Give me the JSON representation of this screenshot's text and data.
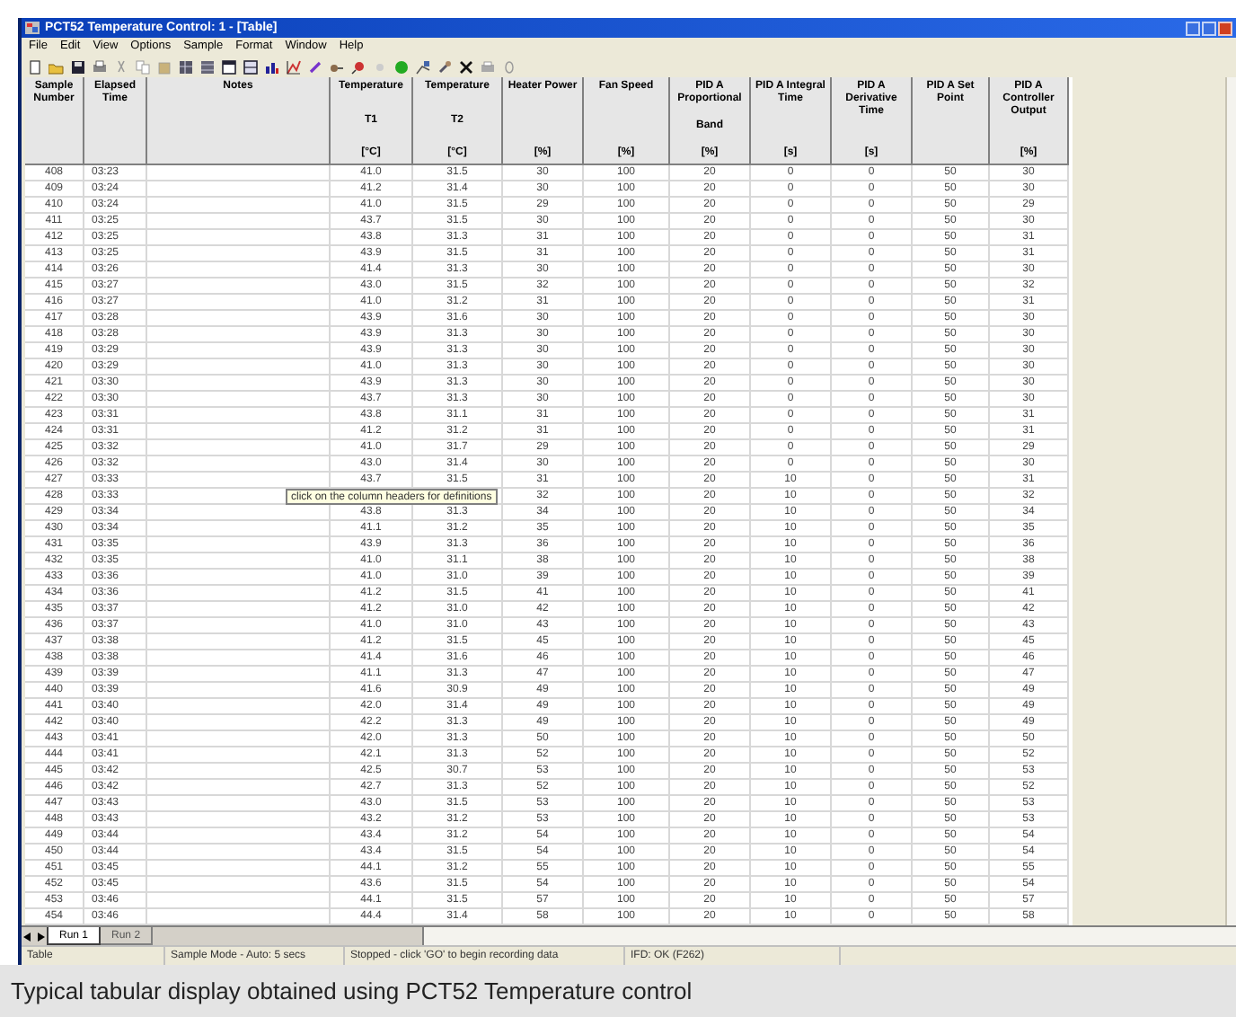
{
  "window": {
    "title": "PCT52 Temperature Control: 1 - [Table]"
  },
  "menu": [
    "File",
    "Edit",
    "View",
    "Options",
    "Sample",
    "Format",
    "Window",
    "Help"
  ],
  "table": {
    "columns": [
      {
        "title": "Sample Number"
      },
      {
        "title": "Elapsed Time"
      },
      {
        "title": "Notes"
      },
      {
        "title": "Temperature",
        "symbol": "T1",
        "unit": "[°C]"
      },
      {
        "title": "Temperature",
        "symbol": "T2",
        "unit": "[°C]"
      },
      {
        "title": "Heater Power",
        "unit": "[%]"
      },
      {
        "title": "Fan Speed",
        "unit": "[%]"
      },
      {
        "title": "PID A Proportional",
        "symbol": "Band",
        "unit": "[%]"
      },
      {
        "title": "PID A Integral Time",
        "unit": "[s]"
      },
      {
        "title": "PID A Derivative Time",
        "unit": "[s]"
      },
      {
        "title": "PID A Set Point"
      },
      {
        "title": "PID A Controller Output",
        "unit": "[%]"
      }
    ],
    "rows": [
      [
        "408",
        "03:23",
        "",
        "41.0",
        "31.5",
        "30",
        "100",
        "20",
        "0",
        "0",
        "50",
        "30"
      ],
      [
        "409",
        "03:24",
        "",
        "41.2",
        "31.4",
        "30",
        "100",
        "20",
        "0",
        "0",
        "50",
        "30"
      ],
      [
        "410",
        "03:24",
        "",
        "41.0",
        "31.5",
        "29",
        "100",
        "20",
        "0",
        "0",
        "50",
        "29"
      ],
      [
        "411",
        "03:25",
        "",
        "43.7",
        "31.5",
        "30",
        "100",
        "20",
        "0",
        "0",
        "50",
        "30"
      ],
      [
        "412",
        "03:25",
        "",
        "43.8",
        "31.3",
        "31",
        "100",
        "20",
        "0",
        "0",
        "50",
        "31"
      ],
      [
        "413",
        "03:25",
        "",
        "43.9",
        "31.5",
        "31",
        "100",
        "20",
        "0",
        "0",
        "50",
        "31"
      ],
      [
        "414",
        "03:26",
        "",
        "41.4",
        "31.3",
        "30",
        "100",
        "20",
        "0",
        "0",
        "50",
        "30"
      ],
      [
        "415",
        "03:27",
        "",
        "43.0",
        "31.5",
        "32",
        "100",
        "20",
        "0",
        "0",
        "50",
        "32"
      ],
      [
        "416",
        "03:27",
        "",
        "41.0",
        "31.2",
        "31",
        "100",
        "20",
        "0",
        "0",
        "50",
        "31"
      ],
      [
        "417",
        "03:28",
        "",
        "43.9",
        "31.6",
        "30",
        "100",
        "20",
        "0",
        "0",
        "50",
        "30"
      ],
      [
        "418",
        "03:28",
        "",
        "43.9",
        "31.3",
        "30",
        "100",
        "20",
        "0",
        "0",
        "50",
        "30"
      ],
      [
        "419",
        "03:29",
        "",
        "43.9",
        "31.3",
        "30",
        "100",
        "20",
        "0",
        "0",
        "50",
        "30"
      ],
      [
        "420",
        "03:29",
        "",
        "41.0",
        "31.3",
        "30",
        "100",
        "20",
        "0",
        "0",
        "50",
        "30"
      ],
      [
        "421",
        "03:30",
        "",
        "43.9",
        "31.3",
        "30",
        "100",
        "20",
        "0",
        "0",
        "50",
        "30"
      ],
      [
        "422",
        "03:30",
        "",
        "43.7",
        "31.3",
        "30",
        "100",
        "20",
        "0",
        "0",
        "50",
        "30"
      ],
      [
        "423",
        "03:31",
        "",
        "43.8",
        "31.1",
        "31",
        "100",
        "20",
        "0",
        "0",
        "50",
        "31"
      ],
      [
        "424",
        "03:31",
        "",
        "41.2",
        "31.2",
        "31",
        "100",
        "20",
        "0",
        "0",
        "50",
        "31"
      ],
      [
        "425",
        "03:32",
        "",
        "41.0",
        "31.7",
        "29",
        "100",
        "20",
        "0",
        "0",
        "50",
        "29"
      ],
      [
        "426",
        "03:32",
        "",
        "43.0",
        "31.4",
        "30",
        "100",
        "20",
        "0",
        "0",
        "50",
        "30"
      ],
      [
        "427",
        "03:33",
        "",
        "43.7",
        "31.5",
        "31",
        "100",
        "20",
        "10",
        "0",
        "50",
        "31"
      ],
      [
        "428",
        "03:33",
        "",
        "",
        "",
        "32",
        "100",
        "20",
        "10",
        "0",
        "50",
        "32"
      ],
      [
        "429",
        "03:34",
        "",
        "43.8",
        "31.3",
        "34",
        "100",
        "20",
        "10",
        "0",
        "50",
        "34"
      ],
      [
        "430",
        "03:34",
        "",
        "41.1",
        "31.2",
        "35",
        "100",
        "20",
        "10",
        "0",
        "50",
        "35"
      ],
      [
        "431",
        "03:35",
        "",
        "43.9",
        "31.3",
        "36",
        "100",
        "20",
        "10",
        "0",
        "50",
        "36"
      ],
      [
        "432",
        "03:35",
        "",
        "41.0",
        "31.1",
        "38",
        "100",
        "20",
        "10",
        "0",
        "50",
        "38"
      ],
      [
        "433",
        "03:36",
        "",
        "41.0",
        "31.0",
        "39",
        "100",
        "20",
        "10",
        "0",
        "50",
        "39"
      ],
      [
        "434",
        "03:36",
        "",
        "41.2",
        "31.5",
        "41",
        "100",
        "20",
        "10",
        "0",
        "50",
        "41"
      ],
      [
        "435",
        "03:37",
        "",
        "41.2",
        "31.0",
        "42",
        "100",
        "20",
        "10",
        "0",
        "50",
        "42"
      ],
      [
        "436",
        "03:37",
        "",
        "41.0",
        "31.0",
        "43",
        "100",
        "20",
        "10",
        "0",
        "50",
        "43"
      ],
      [
        "437",
        "03:38",
        "",
        "41.2",
        "31.5",
        "45",
        "100",
        "20",
        "10",
        "0",
        "50",
        "45"
      ],
      [
        "438",
        "03:38",
        "",
        "41.4",
        "31.6",
        "46",
        "100",
        "20",
        "10",
        "0",
        "50",
        "46"
      ],
      [
        "439",
        "03:39",
        "",
        "41.1",
        "31.3",
        "47",
        "100",
        "20",
        "10",
        "0",
        "50",
        "47"
      ],
      [
        "440",
        "03:39",
        "",
        "41.6",
        "30.9",
        "49",
        "100",
        "20",
        "10",
        "0",
        "50",
        "49"
      ],
      [
        "441",
        "03:40",
        "",
        "42.0",
        "31.4",
        "49",
        "100",
        "20",
        "10",
        "0",
        "50",
        "49"
      ],
      [
        "442",
        "03:40",
        "",
        "42.2",
        "31.3",
        "49",
        "100",
        "20",
        "10",
        "0",
        "50",
        "49"
      ],
      [
        "443",
        "03:41",
        "",
        "42.0",
        "31.3",
        "50",
        "100",
        "20",
        "10",
        "0",
        "50",
        "50"
      ],
      [
        "444",
        "03:41",
        "",
        "42.1",
        "31.3",
        "52",
        "100",
        "20",
        "10",
        "0",
        "50",
        "52"
      ],
      [
        "445",
        "03:42",
        "",
        "42.5",
        "30.7",
        "53",
        "100",
        "20",
        "10",
        "0",
        "50",
        "53"
      ],
      [
        "446",
        "03:42",
        "",
        "42.7",
        "31.3",
        "52",
        "100",
        "20",
        "10",
        "0",
        "50",
        "52"
      ],
      [
        "447",
        "03:43",
        "",
        "43.0",
        "31.5",
        "53",
        "100",
        "20",
        "10",
        "0",
        "50",
        "53"
      ],
      [
        "448",
        "03:43",
        "",
        "43.2",
        "31.2",
        "53",
        "100",
        "20",
        "10",
        "0",
        "50",
        "53"
      ],
      [
        "449",
        "03:44",
        "",
        "43.4",
        "31.2",
        "54",
        "100",
        "20",
        "10",
        "0",
        "50",
        "54"
      ],
      [
        "450",
        "03:44",
        "",
        "43.4",
        "31.5",
        "54",
        "100",
        "20",
        "10",
        "0",
        "50",
        "54"
      ],
      [
        "451",
        "03:45",
        "",
        "44.1",
        "31.2",
        "55",
        "100",
        "20",
        "10",
        "0",
        "50",
        "55"
      ],
      [
        "452",
        "03:45",
        "",
        "43.6",
        "31.5",
        "54",
        "100",
        "20",
        "10",
        "0",
        "50",
        "54"
      ],
      [
        "453",
        "03:46",
        "",
        "44.1",
        "31.5",
        "57",
        "100",
        "20",
        "10",
        "0",
        "50",
        "57"
      ],
      [
        "454",
        "03:46",
        "",
        "44.4",
        "31.4",
        "58",
        "100",
        "20",
        "10",
        "0",
        "50",
        "58"
      ]
    ]
  },
  "tooltip": "click on the column headers for definitions",
  "sheet_tabs": [
    {
      "label": "Run 1",
      "selected": true
    },
    {
      "label": "Run 2",
      "selected": false
    }
  ],
  "status_bar": [
    "Table",
    "Sample Mode - Auto: 5 secs",
    "Stopped - click 'GO' to begin recording data",
    "IFD: OK (F262)"
  ],
  "caption": "Typical tabular display obtained using PCT52 Temperature control"
}
